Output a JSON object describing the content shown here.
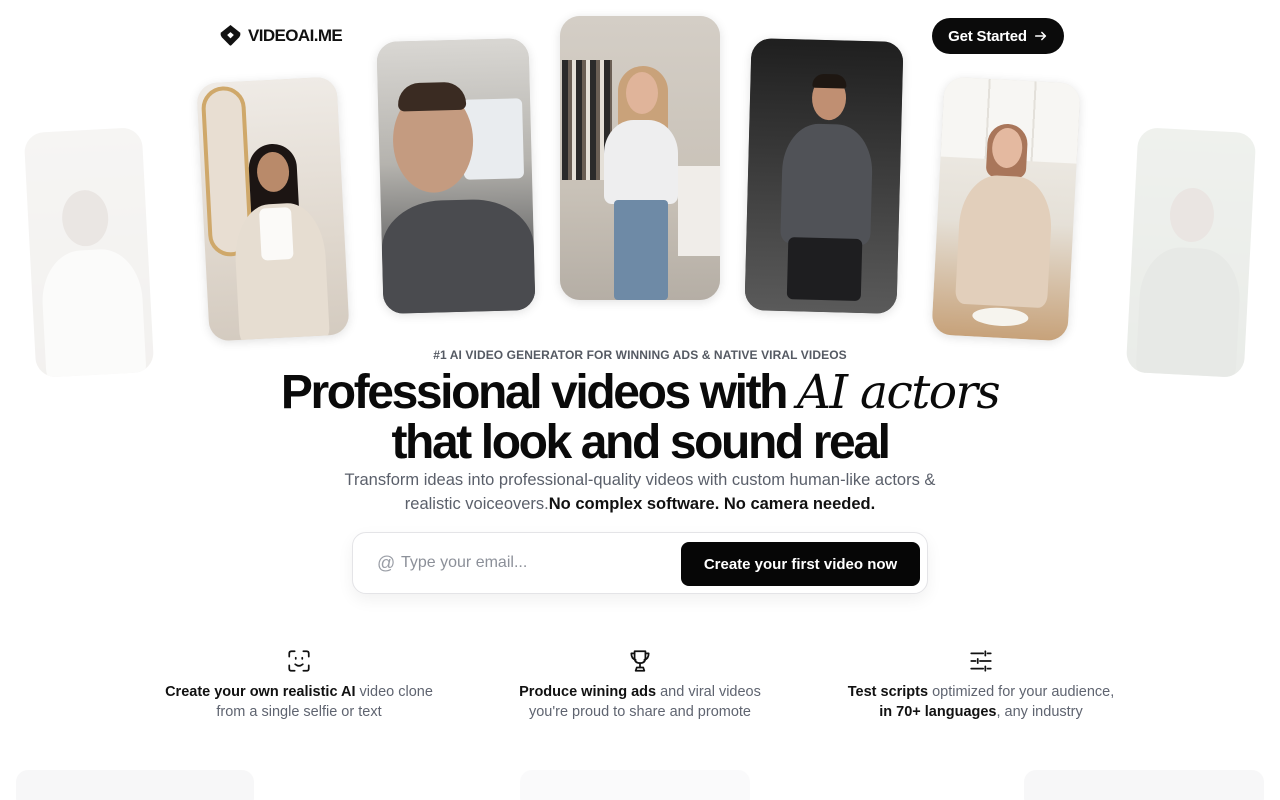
{
  "header": {
    "brand": "VIDEOAI.ME",
    "cta_label": "Get Started"
  },
  "hero": {
    "eyebrow": "#1 AI VIDEO GENERATOR FOR WINNING ADS & NATIVE VIRAL VIDEOS",
    "headline_part1": "Professional videos with ",
    "headline_italic": "AI actors",
    "headline_line2": "that look and sound real",
    "sub_text": "Transform ideas into professional-quality videos with custom human-like actors & realistic voiceovers.",
    "sub_bold": "No complex software. No camera needed."
  },
  "form": {
    "at_symbol": "@",
    "placeholder": "Type your email...",
    "button_label": "Create your first video now"
  },
  "features": [
    {
      "icon": "face-scan-icon",
      "bold": "Create your own realistic AI",
      "rest1": " video clone",
      "line2": "from a single selfie or text"
    },
    {
      "icon": "trophy-icon",
      "bold": "Produce wining ads",
      "rest1": " and viral videos",
      "line2": "you're proud to share and promote"
    },
    {
      "icon": "sliders-icon",
      "bold": "Test scripts",
      "rest1": " optimized for your audience,",
      "line2_bold": "in 70+ languages",
      "line2_rest": ", any industry"
    }
  ],
  "colors": {
    "primary": "#0b0b0b",
    "text_muted": "#5b606b",
    "eyebrow": "#555a63",
    "background": "#ffffff"
  }
}
